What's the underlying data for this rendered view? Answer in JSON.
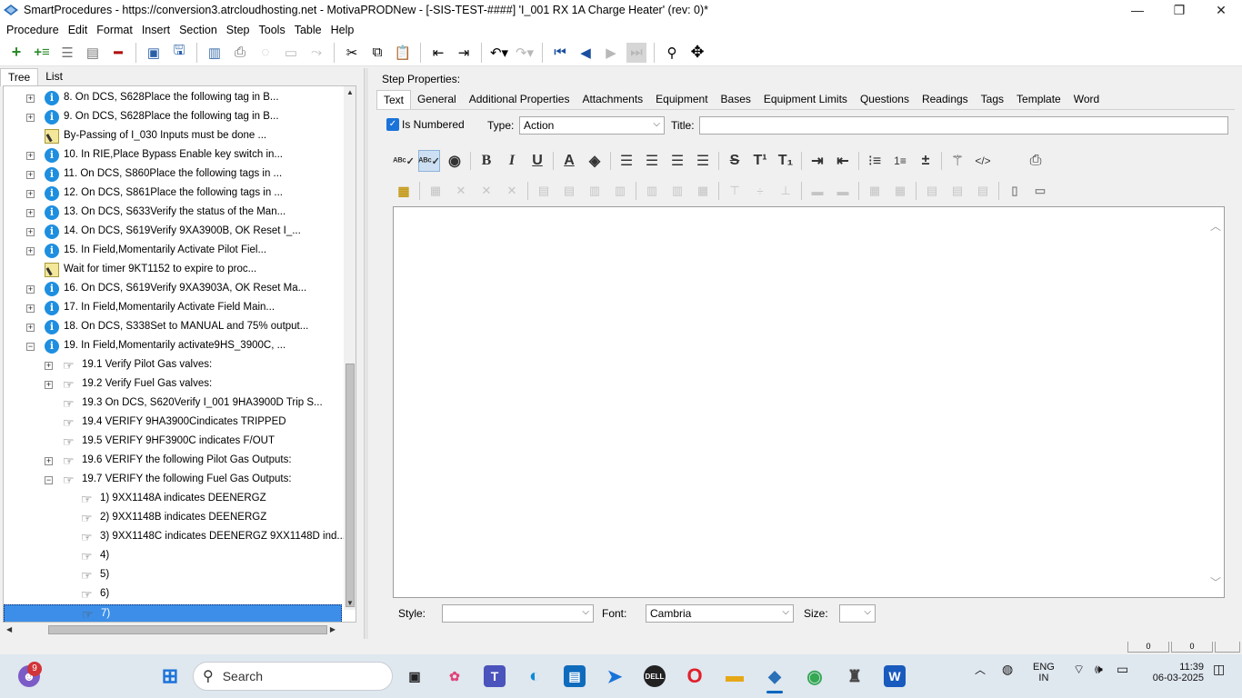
{
  "window": {
    "title": "SmartProcedures - https://conversion3.atrcloudhosting.net - MotivaPRODNew - [-SIS-TEST-####] 'I_001 RX 1A Charge Heater' (rev: 0)*",
    "minimize": "—",
    "maximize": "❐",
    "close": "✕"
  },
  "menu": [
    {
      "label": "Procedure"
    },
    {
      "label": "Edit"
    },
    {
      "label": "Format"
    },
    {
      "label": "Insert"
    },
    {
      "label": "Section"
    },
    {
      "label": "Step"
    },
    {
      "label": "Tools"
    },
    {
      "label": "Table"
    },
    {
      "label": "Help"
    }
  ],
  "left_tabs": {
    "tree": "Tree",
    "list": "List"
  },
  "tree": [
    {
      "text": "8. On DCS, S628Place the following tag in B...",
      "icon": "info-icon",
      "expander": "+"
    },
    {
      "text": "9. On DCS, S628Place the following tag in B...",
      "icon": "info-icon",
      "expander": "+"
    },
    {
      "text": "By-Passing of I_030 Inputs must be done ...",
      "icon": "note-icon",
      "expander": ""
    },
    {
      "text": "10. In RIE,Place Bypass Enable key switch in...",
      "icon": "info-icon",
      "expander": "+"
    },
    {
      "text": "11. On DCS, S860Place the following tags in ...",
      "icon": "info-icon",
      "expander": "+"
    },
    {
      "text": "12. On DCS, S861Place the following tags in ...",
      "icon": "info-icon",
      "expander": "+"
    },
    {
      "text": "13. On DCS, S633Verify the status of the Man...",
      "icon": "info-icon",
      "expander": "+"
    },
    {
      "text": "14. On DCS, S619Verify 9XA3900B, OK Reset I_...",
      "icon": "info-icon",
      "expander": "+"
    },
    {
      "text": "15. In Field,Momentarily Activate Pilot Fiel...",
      "icon": "info-icon",
      "expander": "+"
    },
    {
      "text": "Wait for timer 9KT1152 to expire to proc...",
      "icon": "note-icon",
      "expander": ""
    },
    {
      "text": "16. On DCS, S619Verify 9XA3903A, OK Reset Ma...",
      "icon": "info-icon",
      "expander": "+"
    },
    {
      "text": "17. In Field,Momentarily Activate Field Main...",
      "icon": "info-icon",
      "expander": "+"
    },
    {
      "text": "18. On DCS, S338Set to MANUAL and 75% output...",
      "icon": "info-icon",
      "expander": "+"
    },
    {
      "text": "19. In Field,Momentarily activate9HS_3900C, ...",
      "icon": "info-icon",
      "expander": "−"
    },
    {
      "text": "19.1 Verify Pilot Gas valves:",
      "icon": "hand-icon",
      "expander": "+"
    },
    {
      "text": "19.2 Verify Fuel Gas valves:",
      "icon": "hand-icon",
      "expander": "+"
    },
    {
      "text": "19.3 On DCS, S620Verify I_001 9HA3900D Trip S...",
      "icon": "hand-icon",
      "expander": ""
    },
    {
      "text": "19.4 VERIFY 9HA3900Cindicates TRIPPED",
      "icon": "hand-icon",
      "expander": ""
    },
    {
      "text": "19.5 VERIFY 9HF3900C indicates F/OUT",
      "icon": "hand-icon",
      "expander": ""
    },
    {
      "text": "19.6 VERIFY the following Pilot Gas Outputs:",
      "icon": "hand-icon",
      "expander": "+"
    },
    {
      "text": "19.7 VERIFY the following Fuel Gas Outputs:",
      "icon": "hand-icon",
      "expander": "−"
    },
    {
      "text": "1) 9XX1148A indicates DEENERGZ",
      "icon": "hand-icon",
      "expander": ""
    },
    {
      "text": "2) 9XX1148B indicates DEENERGZ",
      "icon": "hand-icon",
      "expander": ""
    },
    {
      "text": "3) 9XX1148C indicates DEENERGZ 9XX1148D ind...",
      "icon": "hand-icon",
      "expander": ""
    },
    {
      "text": "4)",
      "icon": "hand-icon",
      "expander": ""
    },
    {
      "text": "5)",
      "icon": "hand-icon",
      "expander": ""
    },
    {
      "text": "6)",
      "icon": "hand-icon",
      "expander": ""
    },
    {
      "text": "7)",
      "icon": "hand-icon",
      "expander": "",
      "selected": true
    }
  ],
  "step_properties": {
    "heading": "Step Properties:",
    "tabs": [
      "Text",
      "General",
      "Additional Properties",
      "Attachments",
      "Equipment",
      "Bases",
      "Equipment Limits",
      "Questions",
      "Readings",
      "Tags",
      "Template",
      "Word"
    ],
    "is_numbered_label": "Is Numbered",
    "type_label": "Type:",
    "type_value": "Action",
    "title_label": "Title:",
    "title_value": "",
    "style_label": "Style:",
    "style_value": "",
    "font_label": "Font:",
    "font_value": "Cambria",
    "size_label": "Size:",
    "size_value": ""
  },
  "status_boxes": [
    "0",
    "0",
    ""
  ],
  "taskbar": {
    "notification_count": "9",
    "search_placeholder": "Search",
    "language": "ENG",
    "region": "IN",
    "time": "11:39",
    "date": "06-03-2025"
  }
}
